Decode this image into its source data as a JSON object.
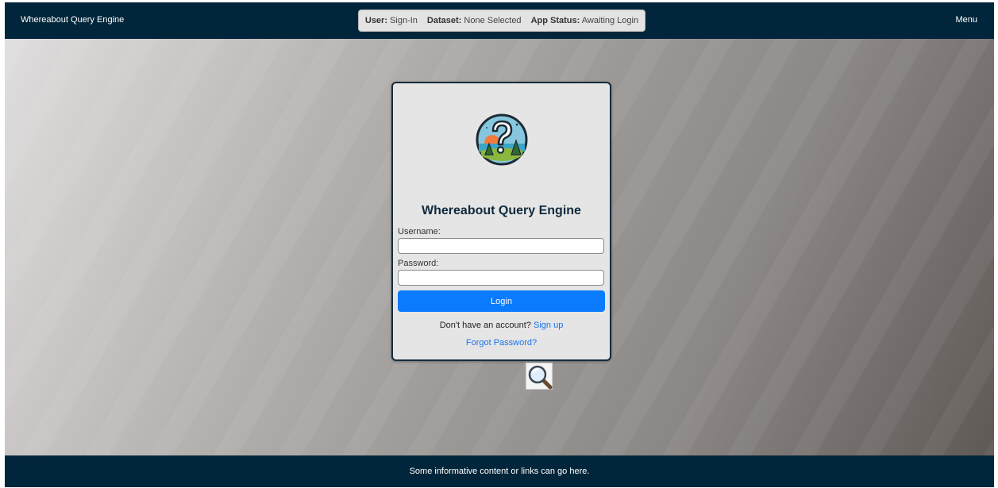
{
  "header": {
    "app_name": "Whereabout Query Engine",
    "status": {
      "user_label": "User:",
      "user_value": "Sign-In",
      "dataset_label": "Dataset:",
      "dataset_value": "None Selected",
      "app_status_label": "App Status:",
      "app_status_value": "Awaiting Login"
    },
    "menu_label": "Menu"
  },
  "login": {
    "title": "Whereabout Query Engine",
    "username_label": "Username:",
    "username_value": "",
    "password_label": "Password:",
    "password_value": "",
    "login_button": "Login",
    "signup_prompt": "Don't have an account?",
    "signup_link": "Sign up",
    "forgot_link": "Forgot Password?"
  },
  "footer": {
    "text": "Some informative content or links can go here."
  },
  "icons": {
    "logo": "question-mark-landscape-logo",
    "magnifier": "magnifier-icon"
  },
  "colors": {
    "navbar_bg": "#01263b",
    "login_button_bg": "#0a7bfd",
    "link": "#1a73e8",
    "card_border": "#142c3d",
    "title_text": "#102a3d"
  }
}
